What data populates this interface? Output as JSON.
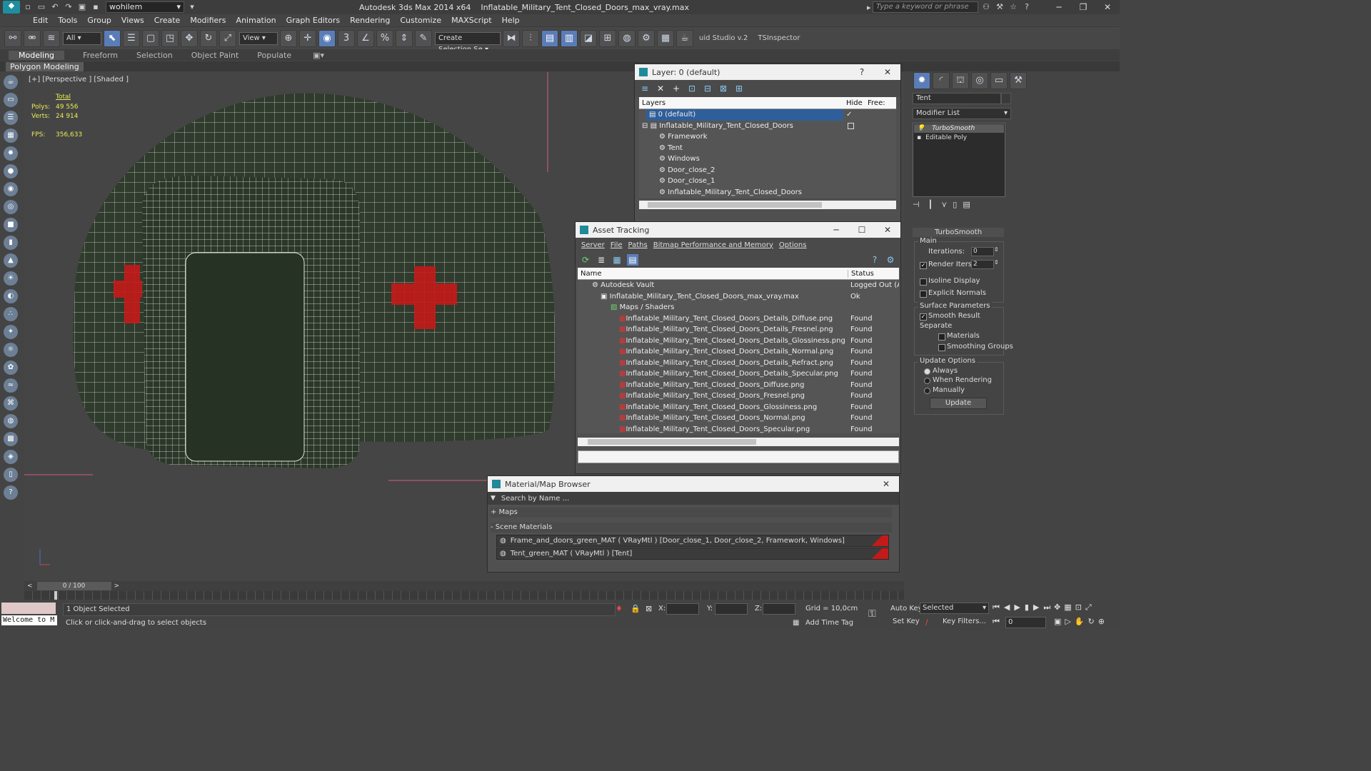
{
  "titlebar": {
    "workspace": "wohilem",
    "app_title": "Autodesk 3ds Max  2014 x64",
    "file_name": "Inflatable_Military_Tent_Closed_Doors_max_vray.max",
    "search_placeholder": "Type a keyword or phrase"
  },
  "menus": [
    "Edit",
    "Tools",
    "Group",
    "Views",
    "Create",
    "Modifiers",
    "Animation",
    "Graph Editors",
    "Rendering",
    "Customize",
    "MAXScript",
    "Help"
  ],
  "toolbar": {
    "selection_filter": "All",
    "reference_coord": "View",
    "named_selection": "Create Selection Se",
    "plugin1": "uid Studio v.2",
    "plugin2": "TSInspector"
  },
  "ribbon": {
    "tabs": [
      "Modeling",
      "Freeform",
      "Selection",
      "Object Paint",
      "Populate"
    ],
    "active": "Modeling",
    "panel_label": "Polygon Modeling"
  },
  "viewport": {
    "label": "[+] [Perspective ] [Shaded ]",
    "stats_total": "Total",
    "polys_label": "Polys:",
    "polys_value": "49 556",
    "verts_label": "Verts:",
    "verts_value": "24 914",
    "fps_label": "FPS:",
    "fps_value": "356,633"
  },
  "layer_panel": {
    "title": "Layer: 0 (default)",
    "help": "?",
    "col_layers": "Layers",
    "col_hide": "Hide",
    "col_freeze": "Free:",
    "rows": [
      {
        "label": "0 (default)",
        "indent": 0
      },
      {
        "label": "Inflatable_Military_Tent_Closed_Doors",
        "indent": 0
      },
      {
        "label": "Framework",
        "indent": 1
      },
      {
        "label": "Tent",
        "indent": 1
      },
      {
        "label": "Windows",
        "indent": 1
      },
      {
        "label": "Door_close_2",
        "indent": 1
      },
      {
        "label": "Door_close_1",
        "indent": 1
      },
      {
        "label": "Inflatable_Military_Tent_Closed_Doors",
        "indent": 1
      }
    ]
  },
  "asset_tracking": {
    "title": "Asset Tracking",
    "menu": [
      "Server",
      "File",
      "Paths",
      "Bitmap Performance and Memory",
      "Options"
    ],
    "col_name": "Name",
    "col_status": "Status",
    "rows": [
      {
        "name": "Autodesk Vault",
        "status": "Logged Out (As",
        "indent": 1
      },
      {
        "name": "Inflatable_Military_Tent_Closed_Doors_max_vray.max",
        "status": "Ok",
        "indent": 2
      },
      {
        "name": "Maps / Shaders",
        "status": "",
        "indent": 3
      },
      {
        "name": "Inflatable_Military_Tent_Closed_Doors_Details_Diffuse.png",
        "status": "Found",
        "indent": 4
      },
      {
        "name": "Inflatable_Military_Tent_Closed_Doors_Details_Fresnel.png",
        "status": "Found",
        "indent": 4
      },
      {
        "name": "Inflatable_Military_Tent_Closed_Doors_Details_Glossiness.png",
        "status": "Found",
        "indent": 4
      },
      {
        "name": "Inflatable_Military_Tent_Closed_Doors_Details_Normal.png",
        "status": "Found",
        "indent": 4
      },
      {
        "name": "Inflatable_Military_Tent_Closed_Doors_Details_Refract.png",
        "status": "Found",
        "indent": 4
      },
      {
        "name": "Inflatable_Military_Tent_Closed_Doors_Details_Specular.png",
        "status": "Found",
        "indent": 4
      },
      {
        "name": "Inflatable_Military_Tent_Closed_Doors_Diffuse.png",
        "status": "Found",
        "indent": 4
      },
      {
        "name": "Inflatable_Military_Tent_Closed_Doors_Fresnel.png",
        "status": "Found",
        "indent": 4
      },
      {
        "name": "Inflatable_Military_Tent_Closed_Doors_Glossiness.png",
        "status": "Found",
        "indent": 4
      },
      {
        "name": "Inflatable_Military_Tent_Closed_Doors_Normal.png",
        "status": "Found",
        "indent": 4
      },
      {
        "name": "Inflatable_Military_Tent_Closed_Doors_Specular.png",
        "status": "Found",
        "indent": 4
      }
    ]
  },
  "material_browser": {
    "title": "Material/Map Browser",
    "search_placeholder": "Search by Name ...",
    "maps_group": "+ Maps",
    "scene_group": "- Scene Materials",
    "materials": [
      "Frame_and_doors_green_MAT  ( VRayMtl ) [Door_close_1, Door_close_2, Framework, Windows]",
      "Tent_green_MAT  ( VRayMtl )  [Tent]"
    ]
  },
  "command_panel": {
    "object_name": "Tent",
    "modifier_list": "Modifier List",
    "stack": [
      "TurboSmooth",
      "Editable Poly"
    ],
    "rollout_title": "TurboSmooth",
    "main_label": "Main",
    "iterations_label": "Iterations:",
    "iterations_value": "0",
    "render_iters_label": "Render Iters:",
    "render_iters_value": "2",
    "isoline_label": "Isoline Display",
    "explicit_normals_label": "Explicit Normals",
    "surface_params_label": "Surface Parameters",
    "smooth_result_label": "Smooth Result",
    "separate_label": "Separate",
    "materials_label": "Materials",
    "smoothing_groups_label": "Smoothing Groups",
    "update_options_label": "Update Options",
    "always_label": "Always",
    "when_rendering_label": "When Rendering",
    "manually_label": "Manually",
    "update_button": "Update"
  },
  "timeline": {
    "frame": "0 / 100"
  },
  "statusbar": {
    "welcome": "Welcome to M",
    "selected": "1 Object Selected",
    "prompt": "Click or click-and-drag to select objects",
    "x_label": "X:",
    "y_label": "Y:",
    "z_label": "Z:",
    "grid": "Grid = 10,0cm",
    "add_time_tag": "Add Time Tag",
    "auto_key": "Auto Key",
    "set_key": "Set Key",
    "selected_dropdown": "Selected",
    "key_filters": "Key Filters...",
    "frame_value": "0"
  },
  "colors": {
    "accent": "#5a7db8",
    "selection": "#2f5f9a",
    "tent": "#2e3b2a",
    "cross": "#c41a1a",
    "stats": "#eaeb55"
  }
}
